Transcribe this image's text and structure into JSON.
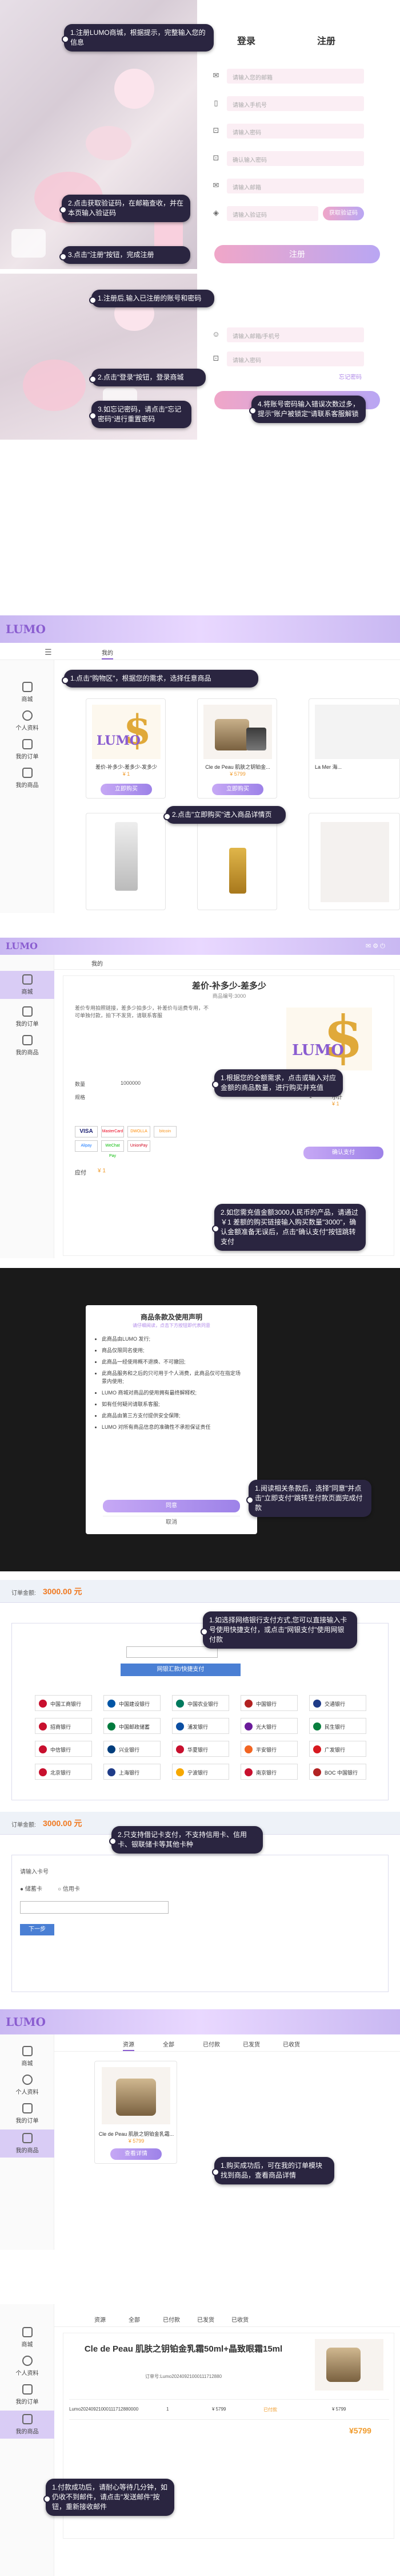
{
  "register": {
    "tab_login": "登录",
    "tab_register": "注册",
    "placeholders": [
      "请输入您的邮箱",
      "请输入手机号",
      "请输入密码",
      "确认输入密码",
      "请输入邮箱",
      "请输入验证码"
    ],
    "verify_button": "获取验证码",
    "submit": "注册",
    "tips": [
      "1.注册LUMO商城，根据提示，完整输入您的信息",
      "2.点击获取验证码，在邮箱查收，并在本页输入验证码",
      "3.点击\"注册\"按钮，完成注册"
    ]
  },
  "login": {
    "placeholders": [
      "请输入邮箱/手机号",
      "请输入密码"
    ],
    "forgot": "忘记密码",
    "submit": "登录",
    "tips": [
      "1.注册后,输入已注册的账号和密码",
      "2.点击\"登录\"按钮，登录商城",
      "3.如忘记密码，请点击\"忘记密码\"进行重置密码",
      "4.将账号密码输入错误次数过多，提示\"账户被锁定\"请联系客服解锁"
    ]
  },
  "shop": {
    "logo": "LUMO",
    "nav_tab": "我的",
    "sidebar": [
      "商城",
      "个人资料",
      "我的订单",
      "我的商品"
    ],
    "products": [
      {
        "name": "差价-补多少-差多少-发多少",
        "price": "¥ 1"
      },
      {
        "name": "Cle de Peau 肌肤之钥铂金...",
        "price": "¥ 5799"
      },
      {
        "name": "La Mer 海...",
        "price": ""
      }
    ],
    "buy_label": "立即购买",
    "tips": [
      "1.点击\"购物区\"，根据您的需求，选择任意商品",
      "2.点击\"立即购买\"进入商品详情页"
    ]
  },
  "detail": {
    "title": "差价-补多少-差多少",
    "subtitle": "商品编号:3000",
    "notice": "差价专用拍照链接，差多少拍多少，补差价与运费专用，不可单独付款，拍下不发货，请联系客服",
    "rows": [
      {
        "label": "数量",
        "value": "1000000"
      },
      {
        "label": "规格",
        "value": "1"
      },
      {
        "label": "小计",
        "value": "¥ 1"
      }
    ],
    "total_label": "应付",
    "total": "¥ 1",
    "pay_button": "确认支付",
    "payments": [
      "VISA",
      "MasterCard",
      "DWOLLA",
      "bitcoin",
      "Alipay",
      "WeChat Pay",
      "UnionPay"
    ],
    "tips": [
      "1.根据您的全额需求，点击或输入对应金额的商品数量，进行购买并充值",
      "2.如您需充值金额3000人民币的产品，请通过￥1 差额的购买链接输入购买数量\"3000\"，确认金额准备无误后，点击\"确认支付\"按钮跳转支付"
    ]
  },
  "agreement": {
    "title": "商品条款及使用声明",
    "subtitle": "请仔细阅读，点击下方按钮即代表同意",
    "items": [
      "此商品由LUMO 发行;",
      "商品仅限同名使用;",
      "此商品一经使用概不退换、不可撤回;",
      "此商品服务和之后的只可用于个人消费，此商品仅可在指定场景内使用;",
      "LUMO 商城对商品的使用拥有最终解释权;",
      "如有任何疑问请联系客服;",
      "此商品由第三方支付提供安全保障;",
      "LUMO 对所有商品信息的准确性不承担保证责任"
    ],
    "agree": "同意",
    "cancel": "取消",
    "tip": "1.阅读相关条款后，选择\"同意\"并点击\"立即支付\"跳转至付款页面完成付款"
  },
  "pay1": {
    "amount_label": "订单金额:",
    "amount": "3000.00 元",
    "method_button": "网银汇款/快捷支付",
    "banks": [
      "中国工商银行",
      "中国建设银行",
      "中国农业银行",
      "中国银行",
      "交通银行",
      "招商银行",
      "中国邮政储蓄",
      "浦发银行",
      "光大银行",
      "民生银行",
      "中信银行",
      "兴业银行",
      "华夏银行",
      "平安银行",
      "广发银行",
      "北京银行",
      "上海银行",
      "宁波银行",
      "南京银行",
      "BOC 中国银行"
    ],
    "tip": "1.如选择网络银行支付方式,您可以直接输入卡号使用快捷支付，或点击\"网银支付\"使用网银付款"
  },
  "pay2": {
    "amount_label": "订单金额:",
    "amount": "3000.00 元",
    "card_label": "请输入卡号",
    "card_types": [
      "储蓄卡",
      "信用卡"
    ],
    "next": "下一步",
    "tip": "2.只支持借记卡支付，不支持信用卡、信用卡、银联储卡等其他卡种"
  },
  "orders": {
    "tabs": [
      "资源",
      "全部",
      "已付款",
      "已发货",
      "已收货"
    ],
    "product": "Cle de Peau 肌肤之钥铂金乳霜...",
    "price": "¥ 5799",
    "view": "查看详情",
    "tip": "1.购买成功后，可在我的订单模块找到商品，查看商品详情"
  },
  "order_detail": {
    "tabs": [
      "资源",
      "全部",
      "已付款",
      "已发货",
      "已收货"
    ],
    "title": "Cle de Peau 肌肤之钥铂金乳霜50ml+晶致眼霜15ml",
    "order_no": "订单号:Lumo20240921000111712880",
    "headers": [
      "订单号",
      "数量",
      "单价",
      "状态",
      "金额"
    ],
    "row": [
      "Lumo20240921000111712880000",
      "1",
      "¥ 5799",
      "已付款",
      "¥ 5799"
    ],
    "total": "¥5799",
    "tip": "1.付款成功后，请耐心等待几分钟，如仍收不到邮件，请点击\"发送邮件\"按钮，重新接收邮件"
  }
}
